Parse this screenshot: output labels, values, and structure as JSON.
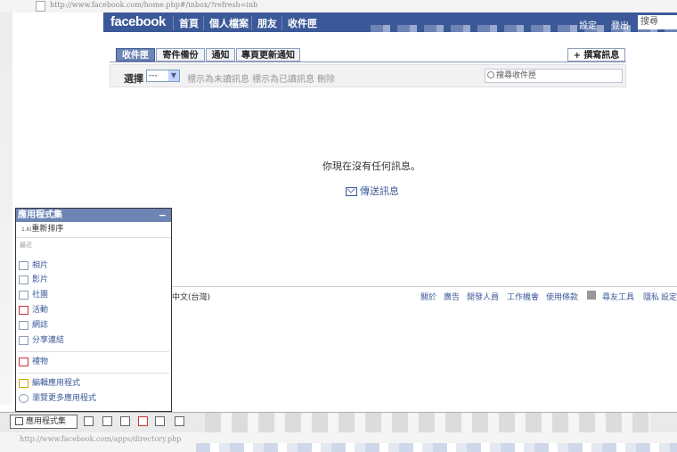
{
  "browser": {
    "url": "http://www.facebook.com/home.php#/inbox/?refresh=inb",
    "status_url": "http://www.facebook.com/apps/directory.php"
  },
  "header": {
    "logo": "facebook",
    "nav": [
      "首頁",
      "個人檔案",
      "朋友",
      "收件匣"
    ],
    "right": [
      "設定",
      "登出"
    ],
    "search": "搜尋"
  },
  "inbox": {
    "tabs": [
      "收件匣",
      "寄件備份",
      "通知",
      "專頁更新通知"
    ],
    "compose": "+ 撰寫訊息",
    "select_label": "選擇",
    "select_value": "---",
    "actions": [
      "標示為未讀訊息",
      "標示為已讀訊息",
      "刪除"
    ],
    "search_placeholder": "搜尋收件匣",
    "empty_message": "你現在沒有任何訊息。",
    "send_message": "傳送訊息"
  },
  "footer": {
    "language": "中文(台灣)",
    "links": [
      "關於",
      "廣告",
      "開發人員",
      "工作機會",
      "使用條款",
      "尋友工具",
      "隱私",
      "設定"
    ]
  },
  "apps_menu": {
    "title": "應用程式集",
    "reorder_prefix": "1.Ki",
    "reorder": "重新排序",
    "section": "最近",
    "items": [
      "相片",
      "影片",
      "社團",
      "活動",
      "網誌",
      "分享連結"
    ],
    "gifts": "禮物",
    "edit": "編輯應用程式",
    "browse": "瀏覽更多應用程式"
  },
  "bottom_bar": {
    "apps_button": "應用程式集"
  }
}
